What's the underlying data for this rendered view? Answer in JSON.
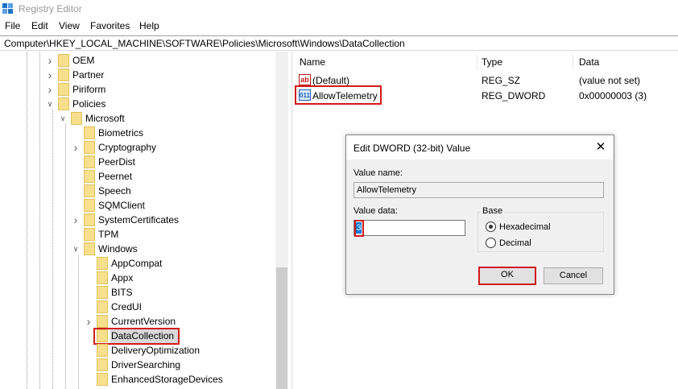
{
  "window": {
    "title": "Registry Editor",
    "icon": "registry-icon"
  },
  "menu": [
    "File",
    "Edit",
    "View",
    "Favorites",
    "Help"
  ],
  "address": "Computer\\HKEY_LOCAL_MACHINE\\SOFTWARE\\Policies\\Microsoft\\Windows\\DataCollection",
  "tree": {
    "nodes": [
      {
        "label": "OEM",
        "expander": "collapsed"
      },
      {
        "label": "Partner",
        "expander": "collapsed"
      },
      {
        "label": "Piriform",
        "expander": "collapsed"
      },
      {
        "label": "Policies",
        "expander": "expanded"
      },
      {
        "label": "Microsoft",
        "expander": "expanded"
      },
      {
        "label": "Biometrics",
        "expander": "none"
      },
      {
        "label": "Cryptography",
        "expander": "collapsed"
      },
      {
        "label": "PeerDist",
        "expander": "none"
      },
      {
        "label": "Peernet",
        "expander": "none"
      },
      {
        "label": "Speech",
        "expander": "none"
      },
      {
        "label": "SQMClient",
        "expander": "none"
      },
      {
        "label": "SystemCertificates",
        "expander": "collapsed"
      },
      {
        "label": "TPM",
        "expander": "none"
      },
      {
        "label": "Windows",
        "expander": "expanded"
      },
      {
        "label": "AppCompat",
        "expander": "none"
      },
      {
        "label": "Appx",
        "expander": "none"
      },
      {
        "label": "BITS",
        "expander": "none"
      },
      {
        "label": "CredUI",
        "expander": "none"
      },
      {
        "label": "CurrentVersion",
        "expander": "collapsed"
      },
      {
        "label": "DataCollection",
        "expander": "none"
      },
      {
        "label": "DeliveryOptimization",
        "expander": "none"
      },
      {
        "label": "DriverSearching",
        "expander": "none"
      },
      {
        "label": "EnhancedStorageDevices",
        "expander": "none"
      }
    ]
  },
  "list": {
    "columns": [
      "Name",
      "Type",
      "Data"
    ],
    "rows": [
      {
        "icon": "string-value-icon",
        "name": "(Default)",
        "type": "REG_SZ",
        "data": "(value not set)"
      },
      {
        "icon": "dword-value-icon",
        "name": "AllowTelemetry",
        "type": "REG_DWORD",
        "data": "0x00000003 (3)"
      }
    ]
  },
  "icons": {
    "string_glyph": "ab",
    "dword_glyph": "011",
    "close_glyph": "✕"
  },
  "dialog": {
    "title": "Edit DWORD (32-bit) Value",
    "value_name_label": "Value name:",
    "value_name": "AllowTelemetry",
    "value_data_label": "Value data:",
    "value_data": "3",
    "base_label": "Base",
    "base_options": [
      "Hexadecimal",
      "Decimal"
    ],
    "base_selected": "Hexadecimal",
    "ok_label": "OK",
    "cancel_label": "Cancel"
  },
  "colors": {
    "highlight": "#d11a1a",
    "folder": "#f8df8e",
    "selection": "#0078d7"
  }
}
